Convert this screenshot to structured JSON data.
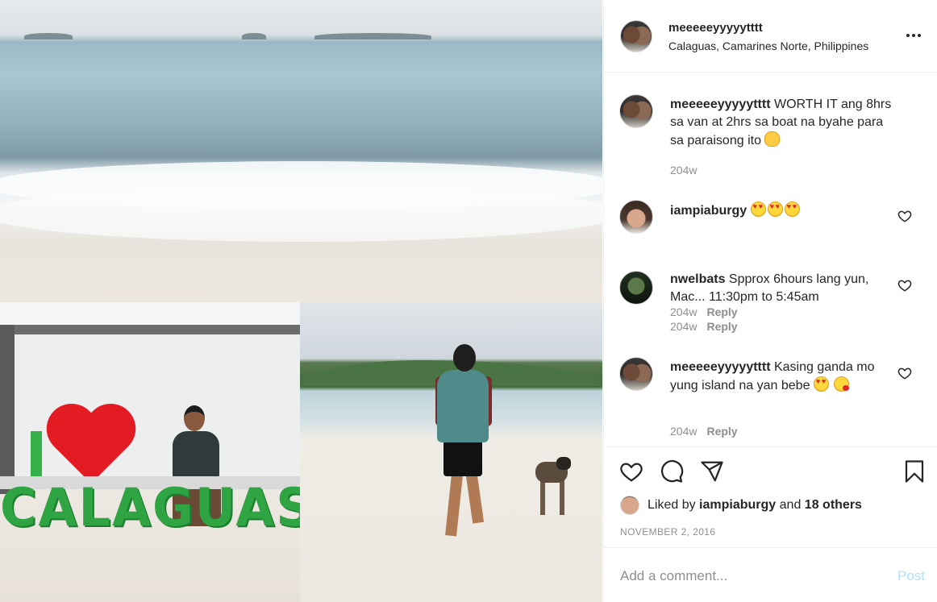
{
  "post": {
    "username": "meeeeeyyyyytttt",
    "location": "Calaguas, Camarines Norte, Philippines",
    "more_icon": "more-horizontal-icon"
  },
  "photo_signs": {
    "letter_i": "I",
    "calaguas": "CALAGUAS"
  },
  "comments": [
    {
      "username": "meeeeeyyyyytttt",
      "text": "WORTH IT ang 8hrs sa van at 2hrs sa boat na byahe para sa paraisong ito",
      "emojis": [
        "ok-hand-emoji"
      ],
      "time": "204w",
      "reply": ""
    },
    {
      "username": "iampiaburgy",
      "text": "",
      "emojis": [
        "heart-eyes-emoji",
        "heart-eyes-emoji",
        "heart-eyes-emoji"
      ],
      "time": "204w",
      "reply": "Reply"
    },
    {
      "username": "nwelbats",
      "text": "Spprox 6hours lang yun, Mac... 11:30pm to 5:45am",
      "emojis": [],
      "time": "204w",
      "reply": "Reply"
    },
    {
      "username": "meeeeeyyyyytttt",
      "text": "Kasing ganda mo yung island na yan bebe",
      "emojis": [
        "heart-eyes-emoji",
        "face-blowing-kiss-emoji"
      ],
      "time": "204w",
      "reply": "Reply"
    }
  ],
  "actions": {
    "icons": [
      "heart-outline-icon",
      "comment-icon",
      "share-icon",
      "bookmark-icon"
    ]
  },
  "likes": {
    "prefix": "Liked by",
    "user": "iampiaburgy",
    "joiner": "and",
    "others": "18 others"
  },
  "date": "NOVEMBER 2, 2016",
  "add_comment": {
    "placeholder": "Add a comment...",
    "post_label": "Post"
  },
  "colors": {
    "text": "#262626",
    "muted": "#8e8e8e",
    "divider": "#efefef",
    "post_disabled": "#b2dffc"
  }
}
